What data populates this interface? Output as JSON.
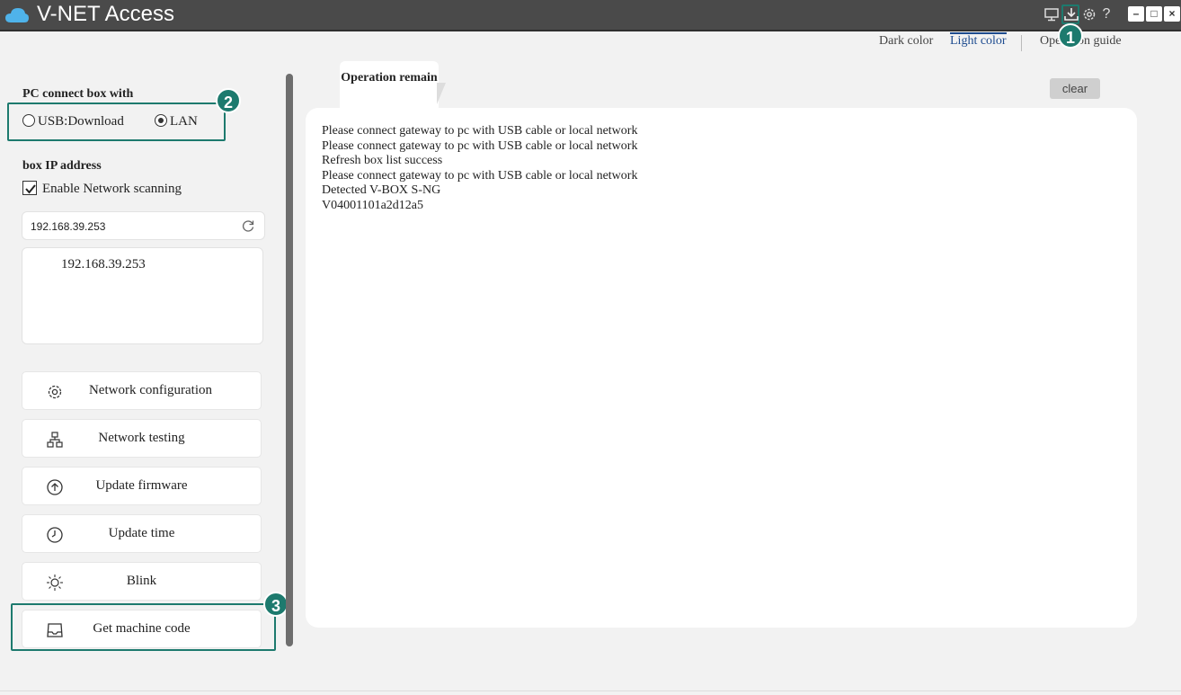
{
  "app": {
    "title": "V-NET Access",
    "accent_color": "#1d7a6e",
    "titlebar_color": "#4a4a4a"
  },
  "titlebar": {
    "icons": [
      "monitor-icon",
      "download-icon",
      "gear-icon",
      "help-icon"
    ],
    "help_glyph": "?",
    "window_controls": {
      "minimize": "–",
      "maximize": "□",
      "close": "×"
    }
  },
  "theme": {
    "dark_label": "Dark color",
    "light_label": "Light color",
    "guide_label": "Operation guide",
    "selected": "Light color"
  },
  "callouts": [
    "1",
    "2",
    "3"
  ],
  "connection": {
    "label": "PC connect box with",
    "options": [
      {
        "label": "USB:Download",
        "selected": false
      },
      {
        "label": "LAN",
        "selected": true
      }
    ]
  },
  "box_ip": {
    "label": "box IP address",
    "scan_label": "Enable Network scanning",
    "scan_checked": true,
    "input_value": "192.168.39.253",
    "list": [
      "192.168.39.253"
    ]
  },
  "actions": [
    {
      "label": "Network configuration",
      "icon": "gear-icon"
    },
    {
      "label": "Network testing",
      "icon": "network-icon"
    },
    {
      "label": "Update firmware",
      "icon": "upload-icon"
    },
    {
      "label": "Update time",
      "icon": "clock-icon"
    },
    {
      "label": "Blink",
      "icon": "sun-icon"
    },
    {
      "label": "Get machine code",
      "icon": "tray-icon"
    }
  ],
  "log": {
    "tab_label": "Operation remain",
    "clear_label": "clear",
    "lines": [
      "Please connect gateway to pc with USB cable or local network",
      "Please connect gateway to pc with USB cable or local network",
      "Refresh box list success",
      "Please connect gateway to pc with USB cable or local network",
      "Detected V-BOX S-NG",
      "V04001101a2d12a5"
    ]
  }
}
